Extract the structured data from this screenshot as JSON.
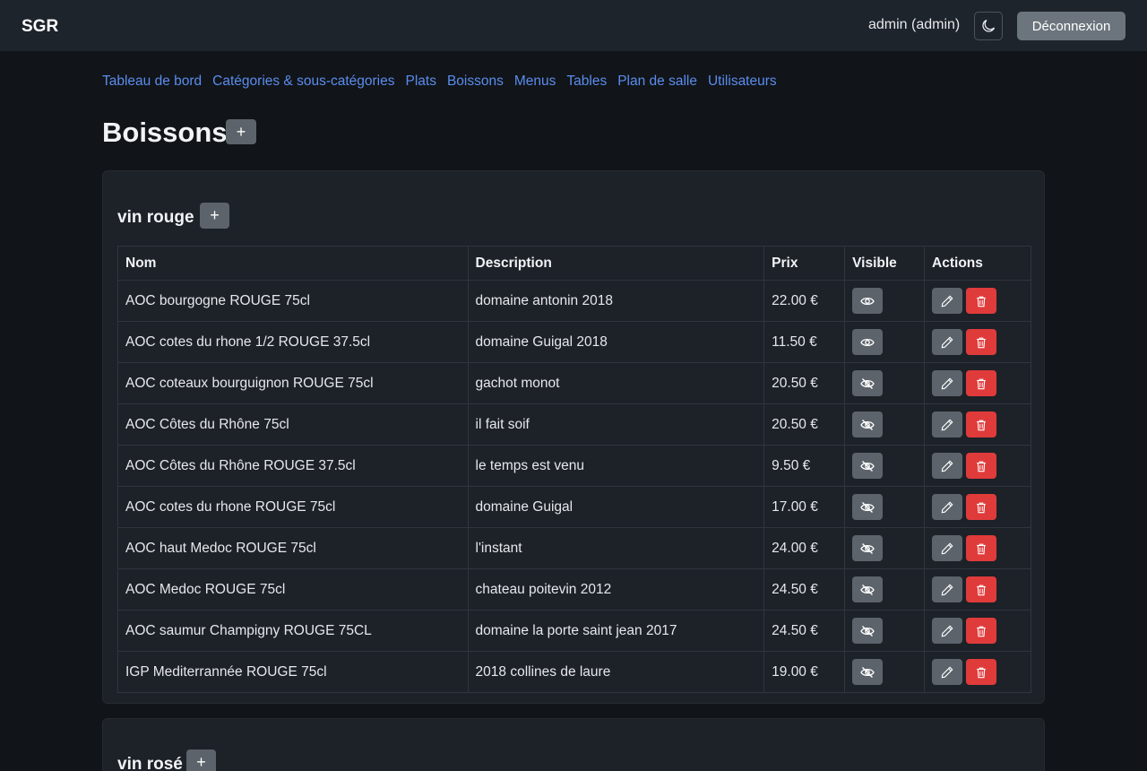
{
  "header": {
    "brand": "SGR",
    "user": "admin (admin)",
    "theme_icon": "moon-icon",
    "logout_label": "Déconnexion"
  },
  "nav": [
    "Tableau de bord",
    "Catégories & sous-catégories",
    "Plats",
    "Boissons",
    "Menus",
    "Tables",
    "Plan de salle",
    "Utilisateurs"
  ],
  "page": {
    "title": "Boissons",
    "add_label": "+"
  },
  "sections": [
    {
      "title": "vin rouge",
      "add_label": "+",
      "columns": [
        "Nom",
        "Description",
        "Prix",
        "Visible",
        "Actions"
      ],
      "rows": [
        {
          "nom": "AOC bourgogne ROUGE 75cl",
          "description": "domaine antonin 2018",
          "prix": "22.00 €",
          "visible": true
        },
        {
          "nom": "AOC cotes du rhone 1/2 ROUGE 37.5cl",
          "description": "domaine Guigal 2018",
          "prix": "11.50 €",
          "visible": true
        },
        {
          "nom": "AOC coteaux bourguignon ROUGE 75cl",
          "description": "gachot monot",
          "prix": "20.50 €",
          "visible": false
        },
        {
          "nom": "AOC Côtes du Rhône 75cl",
          "description": "il fait soif",
          "prix": "20.50 €",
          "visible": false
        },
        {
          "nom": "AOC Côtes du Rhône ROUGE 37.5cl",
          "description": "le temps est venu",
          "prix": "9.50 €",
          "visible": false
        },
        {
          "nom": "AOC cotes du rhone ROUGE 75cl",
          "description": "domaine Guigal",
          "prix": "17.00 €",
          "visible": false
        },
        {
          "nom": "AOC haut Medoc ROUGE 75cl",
          "description": "l'instant",
          "prix": "24.00 €",
          "visible": false
        },
        {
          "nom": "AOC Medoc ROUGE 75cl",
          "description": "chateau poitevin 2012",
          "prix": "24.50 €",
          "visible": false
        },
        {
          "nom": "AOC saumur Champigny ROUGE 75CL",
          "description": "domaine la porte saint jean 2017",
          "prix": "24.50 €",
          "visible": false
        },
        {
          "nom": "IGP Mediterrannée ROUGE 75cl",
          "description": "2018 collines de laure",
          "prix": "19.00 €",
          "visible": false
        }
      ]
    },
    {
      "title": "vin rosé",
      "add_label": "+"
    }
  ],
  "colors": {
    "link": "#5a8dee",
    "danger": "#e03b3b",
    "secondary": "#5c636a"
  }
}
